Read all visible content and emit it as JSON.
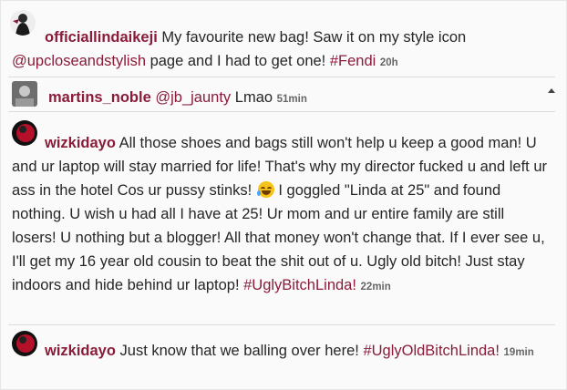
{
  "comments": [
    {
      "username": "officiallindaikeji",
      "text_1": " My favourite new bag! Saw it on my style icon ",
      "mention": "@upcloseandstylish",
      "text_2": " page and I had to get one! ",
      "hashtag": "#Fendi",
      "time": "20h"
    },
    {
      "username": "martins_noble",
      "mention": "@jb_jaunty",
      "text_1": " Lmao ",
      "time": "51min"
    },
    {
      "username": "wizkidayo",
      "text_1": " All those shoes and bags still won't help u keep a good man! U and ur laptop will stay married for life! That's why my director fucked u and left ur ass in the hotel Cos ur pussy stinks! ",
      "emoji": "face-with-tears-of-joy-emoji",
      "text_2": " I goggled \"Linda at 25\" and found nothing. U wish u had all I have at 25! Ur mom and ur entire family are still losers! U nothing but a blogger! All that money won't change that. If I ever see u, I'll get my 16 year old cousin to beat the shit out of u. Ugly old bitch! Just stay indoors and hide behind ur laptop! ",
      "hashtag": "#UglyBitchLinda!",
      "time": "22min"
    },
    {
      "username": "wizkidayo",
      "text_1": " Just know that we balling over here! ",
      "hashtag": "#UglyOldBitchLinda!",
      "time": "19min"
    }
  ]
}
